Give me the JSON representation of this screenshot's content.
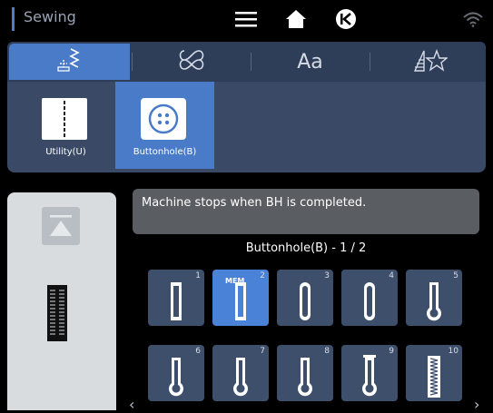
{
  "header": {
    "title": "Sewing"
  },
  "icons": {
    "menu": "menu-icon",
    "home": "home-icon",
    "back": "back-circle-icon",
    "wifi": "wifi-icon"
  },
  "tabs": [
    {
      "id": "utility-stitch",
      "icon": "utility-stitch-icon",
      "label": "",
      "active": true
    },
    {
      "id": "decorative",
      "icon": "decorative-stitch-icon",
      "label": "",
      "active": false
    },
    {
      "id": "character",
      "icon": "",
      "label": "Aa",
      "active": false
    },
    {
      "id": "my-design",
      "icon": "my-design-star-icon",
      "label": "",
      "active": false
    }
  ],
  "categories": [
    {
      "label": "Utility(U)",
      "selected": false
    },
    {
      "label": "Buttonhole(B)",
      "selected": true
    }
  ],
  "message": "Machine stops when BH is completed.",
  "page_indicator": "Buttonhole(B) - 1 / 2",
  "stitches": [
    {
      "num": "1",
      "shape": "square",
      "selected": false
    },
    {
      "num": "2",
      "shape": "square",
      "selected": true,
      "badge": "MEM"
    },
    {
      "num": "3",
      "shape": "rounded",
      "selected": false
    },
    {
      "num": "4",
      "shape": "rounded",
      "selected": false
    },
    {
      "num": "5",
      "shape": "keyhole",
      "selected": false
    },
    {
      "num": "6",
      "shape": "keyhole",
      "selected": false
    },
    {
      "num": "7",
      "shape": "keyhole",
      "selected": false
    },
    {
      "num": "8",
      "shape": "keyhole",
      "selected": false
    },
    {
      "num": "9",
      "shape": "keyhole-bar",
      "selected": false
    },
    {
      "num": "10",
      "shape": "zigzag",
      "selected": false
    }
  ],
  "nav": {
    "prev": "‹",
    "next": "›"
  },
  "colors": {
    "accent": "#4a82d8",
    "tab_active": "#4a7bc8",
    "panel": "#3a4a66"
  }
}
